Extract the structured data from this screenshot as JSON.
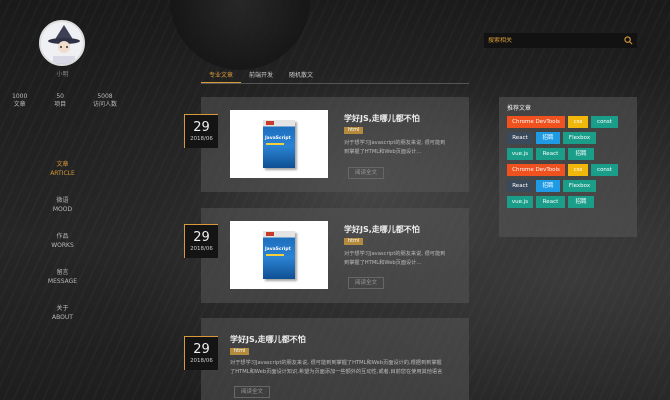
{
  "profile": {
    "username": "小明",
    "stats": [
      {
        "value": "1000",
        "label": "文章"
      },
      {
        "value": "50",
        "label": "项目"
      },
      {
        "value": "5008",
        "label": "访问人数"
      }
    ]
  },
  "nav": [
    {
      "cn": "文章",
      "en": "ARTICLE",
      "active": true
    },
    {
      "cn": "微语",
      "en": "MOOD",
      "active": false
    },
    {
      "cn": "作品",
      "en": "WORKS",
      "active": false
    },
    {
      "cn": "留言",
      "en": "MESSAGE",
      "active": false
    },
    {
      "cn": "关于",
      "en": "ABOUT",
      "active": false
    }
  ],
  "search": {
    "placeholder": "搜索相关"
  },
  "tabs": [
    {
      "label": "专业文章",
      "active": true
    },
    {
      "label": "前端开发",
      "active": false
    },
    {
      "label": "随机散文",
      "active": false
    }
  ],
  "articles": [
    {
      "day": "29",
      "ym": "2018/06",
      "title": "学好JS,走哪儿都不怕",
      "tag": "html",
      "desc": "对于想学习Javascript的朋友来说, 很可能到到掌握了HTML和Web页面设计...",
      "button": "阅读全文",
      "book_title": "JavaScript"
    },
    {
      "day": "29",
      "ym": "2018/06",
      "title": "学好JS,走哪儿都不怕",
      "tag": "html",
      "desc": "对于想学习Javascript的朋友来说, 很可能到到掌握了HTML和Web页面设计...",
      "button": "阅读全文",
      "book_title": "JavaScript"
    },
    {
      "day": "29",
      "ym": "2018/06",
      "title": "学好JS,走哪儿都不怕",
      "tag": "html",
      "desc": "对于想学习Javascript的朋友来说, 很可能到到掌握了HTML和Web页面设计的,根据到到掌握了HTML和Web页面设计知识,希望为页面添加一些额外的互动性,或者,目前您在使用其他语言进行编程,想了解...",
      "button": "阅读全文"
    }
  ],
  "recommended": {
    "title": "推荐文章",
    "rows": [
      [
        {
          "text": "Chrome DevTools",
          "color": "#f0521f"
        },
        {
          "text": "css",
          "color": "#f1b80b"
        },
        {
          "text": "const",
          "color": "#1a9e8a"
        }
      ],
      [
        {
          "text": "React",
          "color": "#3b4a5a"
        },
        {
          "text": "招聘",
          "color": "#1f9be6"
        },
        {
          "text": "Flexbox",
          "color": "#1a9e8a"
        }
      ],
      [
        {
          "text": "vue.js",
          "color": "#1a9e8a"
        },
        {
          "text": "React",
          "color": "#1a9e8a"
        },
        {
          "text": "招聘",
          "color": "#1a9e8a"
        }
      ],
      [
        {
          "text": "Chrome DevTools",
          "color": "#f0521f"
        },
        {
          "text": "css",
          "color": "#f1b80b"
        },
        {
          "text": "const",
          "color": "#1a9e8a"
        }
      ],
      [
        {
          "text": "React",
          "color": "#3b4a5a"
        },
        {
          "text": "招聘",
          "color": "#1f9be6"
        },
        {
          "text": "Flexbox",
          "color": "#1a9e8a"
        }
      ],
      [
        {
          "text": "vue.js",
          "color": "#1a9e8a"
        },
        {
          "text": "React",
          "color": "#1a9e8a"
        },
        {
          "text": "招聘",
          "color": "#1a9e8a"
        }
      ]
    ]
  },
  "colors": {
    "accent": "#d89a3a",
    "tag": "#b48a3c"
  }
}
